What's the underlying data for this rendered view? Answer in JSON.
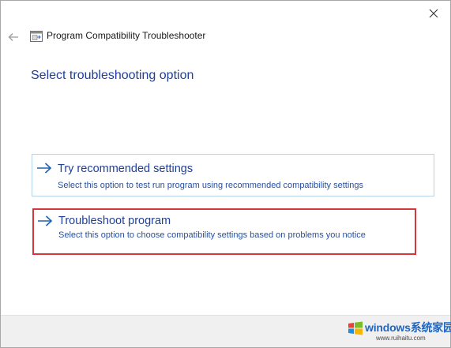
{
  "window": {
    "title": "Program Compatibility Troubleshooter",
    "close_icon": "close-icon",
    "back_icon": "back-arrow-icon"
  },
  "main": {
    "heading": "Select troubleshooting option"
  },
  "options": [
    {
      "title": "Try recommended settings",
      "description": "Select this option to test run program using recommended compatibility settings",
      "icon": "arrow-right-icon"
    },
    {
      "title": "Troubleshoot program",
      "description": "Select this option to choose compatibility settings based on problems you notice",
      "icon": "arrow-right-icon",
      "highlighted": true
    }
  ],
  "watermark": {
    "brand": "windows系统家园",
    "url": "www.ruihaitu.com"
  },
  "colors": {
    "link_blue": "#1f3f99",
    "highlight_red": "#d3373b",
    "option_border": "#b8d4ec",
    "footer_bg": "#f0f0f0"
  }
}
